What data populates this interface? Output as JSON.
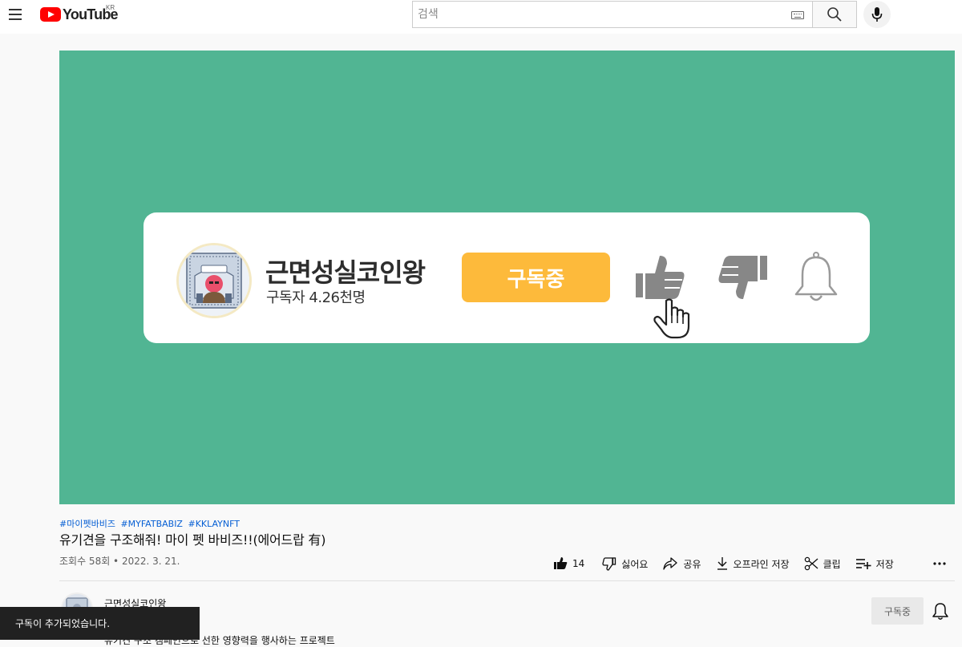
{
  "header": {
    "logo_text": "YouTube",
    "country_code": "KR",
    "search_placeholder": "검색"
  },
  "card": {
    "channel_name": "근면성실코인왕",
    "subscriber_text": "구독자 4.26천명",
    "subscribe_label": "구독중",
    "avatar_banner": "근면성실역의 모든 이",
    "avatar_tag": "근면 성실",
    "colors": {
      "background": "#51b593",
      "subscribe": "#fdba3b",
      "icons": "#878787"
    }
  },
  "video": {
    "hashtags": [
      "#마이펫바비즈",
      "#MYFATBABIZ",
      "#KKLAYNFT"
    ],
    "title": "유기견을 구조해줘! 마이 펫 바비즈!!(에어드랍 有)",
    "stats": "조회수 58회 • 2022. 3. 21."
  },
  "actions": {
    "like_count": "14",
    "dislike_label": "싫어요",
    "share_label": "공유",
    "download_label": "오프라인 저장",
    "clip_label": "클립",
    "save_label": "저장"
  },
  "owner": {
    "name": "근면성실코인왕",
    "subscribe_label": "구독중",
    "description_line": "유기견 구조 캠페인으로 선한 영향력을 행사하는 프로젝트"
  },
  "toast": {
    "message": "구독이 추가되었습니다."
  }
}
